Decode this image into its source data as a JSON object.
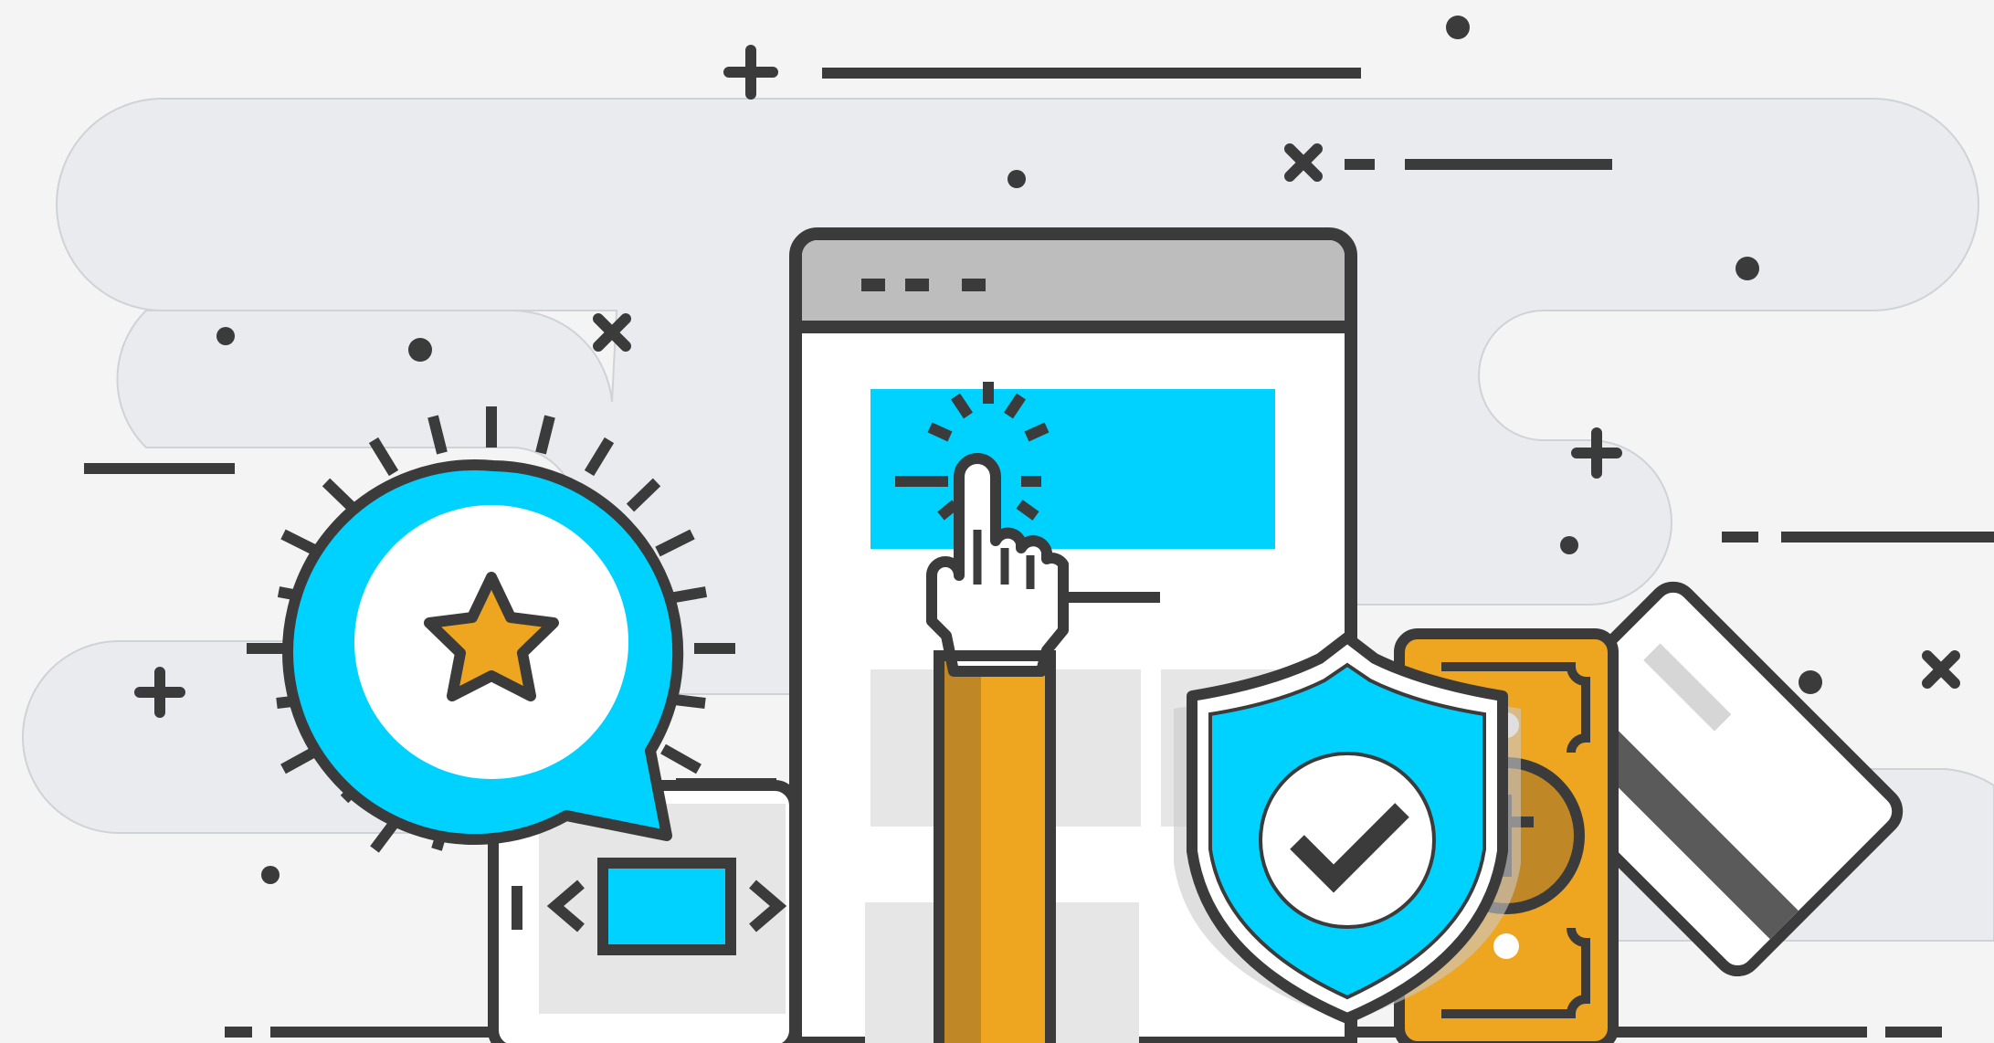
{
  "illustration": {
    "palette": {
      "background": "#f4f4f4",
      "cloud": "#e9ebee",
      "outline": "#3b3b3b",
      "cyan": "#00d2ff",
      "orange": "#eea621",
      "orange_dark": "#c08726",
      "window_bar": "#bdbdbd",
      "panel_grey": "#e6e6e6",
      "white": "#ffffff"
    },
    "elements": [
      "cloud-shapes",
      "browser-window",
      "pointing-hand-icon",
      "rating-speech-bubble",
      "star-icon",
      "responsive-device-icon",
      "security-shield",
      "checkmark-icon",
      "cash-banknote",
      "credit-card",
      "sparkle-decorations"
    ]
  }
}
